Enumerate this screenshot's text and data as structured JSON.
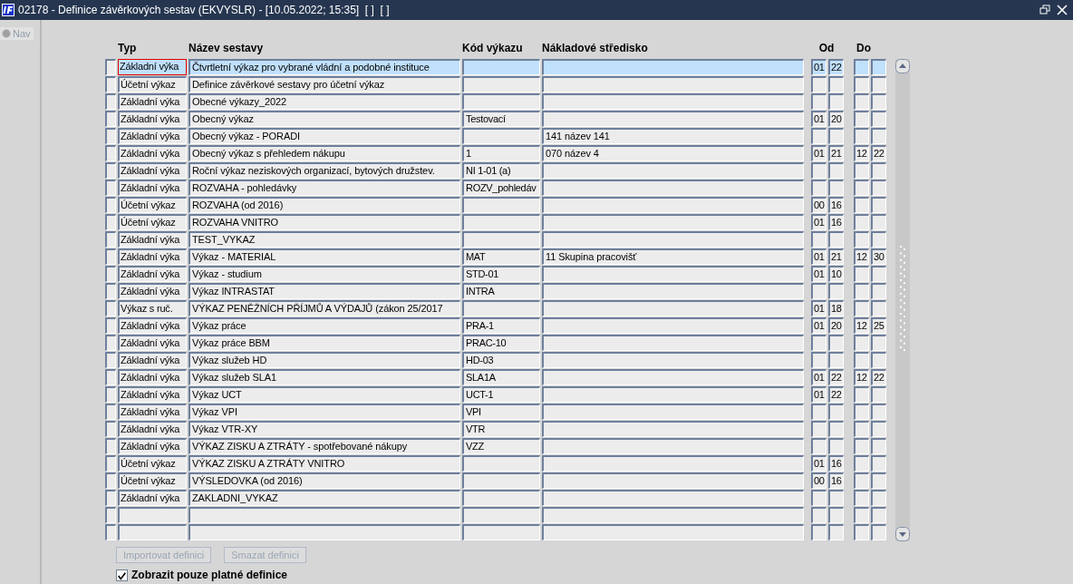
{
  "window": {
    "title": "02178 - Definice závěrkových sestav (EKVYSLR) - [10.05.2022; 15:35]  [ ]  [ ]"
  },
  "nav": {
    "label": "Nav",
    "disabled": true
  },
  "table": {
    "columns": {
      "typ": "Typ",
      "nazev": "Název sestavy",
      "kod": "Kód výkazu",
      "stredisko": "Nákladové středisko",
      "od": "Od",
      "do": "Do"
    },
    "rows": [
      {
        "selected": true,
        "focused": true,
        "typ": "Základní výka",
        "nazev": "Čtvrtletní výkaz pro vybrané vládní a podobné instituce",
        "od": [
          "01",
          "22"
        ]
      },
      {
        "selected": false,
        "focused": false,
        "typ": "Účetní výkaz",
        "nazev": "Definice závěrkové sestavy pro účetní výkaz"
      },
      {
        "selected": false,
        "focused": false,
        "typ": "Základní výka",
        "nazev": "Obecné výkazy_2022"
      },
      {
        "selected": false,
        "focused": false,
        "typ": "Základní výka",
        "nazev": "Obecný výkaz",
        "kod": "Testovací",
        "od": [
          "01",
          "20"
        ]
      },
      {
        "selected": false,
        "focused": false,
        "typ": "Základní výka",
        "nazev": "Obecný výkaz - PORADI",
        "stredisko": "141 název 141"
      },
      {
        "selected": false,
        "focused": false,
        "typ": "Základní výka",
        "nazev": "Obecný výkaz s přehledem nákupu",
        "kod": "1",
        "stredisko": "070 název 4",
        "od": [
          "01",
          "21"
        ],
        "do": [
          "12",
          "22"
        ]
      },
      {
        "selected": false,
        "focused": false,
        "typ": "Základní výka",
        "nazev": "Roční výkaz neziskových organizací, bytových družstev.",
        "kod": "NI 1-01 (a)"
      },
      {
        "selected": false,
        "focused": false,
        "typ": "Základní výka",
        "nazev": "ROZVAHA - pohledávky",
        "kod": "ROZV_pohledáv"
      },
      {
        "selected": false,
        "focused": false,
        "typ": "Účetní výkaz",
        "nazev": "ROZVAHA (od 2016)",
        "od": [
          "00",
          "16"
        ]
      },
      {
        "selected": false,
        "focused": false,
        "typ": "Účetní výkaz",
        "nazev": "ROZVAHA VNITRO",
        "od": [
          "01",
          "16"
        ]
      },
      {
        "selected": false,
        "focused": false,
        "typ": "Základní výka",
        "nazev": "TEST_VYKAZ"
      },
      {
        "selected": false,
        "focused": false,
        "typ": "Základní výka",
        "nazev": "Výkaz - MATERIAL",
        "kod": "MAT",
        "stredisko": "11 Skupina pracovišť",
        "od": [
          "01",
          "21"
        ],
        "do": [
          "12",
          "30"
        ]
      },
      {
        "selected": false,
        "focused": false,
        "typ": "Základní výka",
        "nazev": "Výkaz - studium",
        "kod": "STD-01",
        "od": [
          "01",
          "10"
        ]
      },
      {
        "selected": false,
        "focused": false,
        "typ": "Základní výka",
        "nazev": "Výkaz INTRASTAT",
        "kod": "INTRA"
      },
      {
        "selected": false,
        "focused": false,
        "typ": "Výkaz s ruč.",
        "nazev": "VÝKAZ PENĚŽNÍCH PŘÍJMŮ A VÝDAJŮ (zákon 25/2017",
        "od": [
          "01",
          "18"
        ]
      },
      {
        "selected": false,
        "focused": false,
        "typ": "Základní výka",
        "nazev": "Výkaz práce",
        "kod": "PRA-1",
        "od": [
          "01",
          "20"
        ],
        "do": [
          "12",
          "25"
        ]
      },
      {
        "selected": false,
        "focused": false,
        "typ": "Základní výka",
        "nazev": "Výkaz práce BBM",
        "kod": "PRAC-10"
      },
      {
        "selected": false,
        "focused": false,
        "typ": "Základní výka",
        "nazev": "Výkaz služeb HD",
        "kod": "HD-03"
      },
      {
        "selected": false,
        "focused": false,
        "typ": "Základní výka",
        "nazev": "Výkaz služeb SLA1",
        "kod": "SLA1A",
        "od": [
          "01",
          "22"
        ],
        "do": [
          "12",
          "22"
        ]
      },
      {
        "selected": false,
        "focused": false,
        "typ": "Základní výka",
        "nazev": "Výkaz UCT",
        "kod": "UCT-1",
        "od": [
          "01",
          "22"
        ]
      },
      {
        "selected": false,
        "focused": false,
        "typ": "Základní výka",
        "nazev": "Výkaz VPI",
        "kod": "VPI"
      },
      {
        "selected": false,
        "focused": false,
        "typ": "Základní výka",
        "nazev": "Výkaz VTR-XY",
        "kod": "VTR"
      },
      {
        "selected": false,
        "focused": false,
        "typ": "Základní výka",
        "nazev": "VÝKAZ ZISKU A ZTRÁTY - spotřebované nákupy",
        "kod": "VZZ"
      },
      {
        "selected": false,
        "focused": false,
        "typ": "Účetní výkaz",
        "nazev": "VÝKAZ ZISKU A ZTRÁTY VNITRO",
        "od": [
          "01",
          "16"
        ]
      },
      {
        "selected": false,
        "focused": false,
        "typ": "Účetní výkaz",
        "nazev": "VÝSLEDOVKA (od 2016)",
        "od": [
          "00",
          "16"
        ]
      },
      {
        "selected": false,
        "focused": false,
        "typ": "Základní výka",
        "nazev": "ZAKLADNI_VYKAZ"
      },
      {
        "selected": false,
        "focused": false
      },
      {
        "selected": false,
        "focused": false
      }
    ]
  },
  "buttons": [
    {
      "label": "Importovat definici",
      "disabled": true
    },
    {
      "label": "Smazat definici",
      "disabled": true
    }
  ],
  "filter": {
    "label": "Zobrazit pouze platné definice",
    "checked": true
  }
}
